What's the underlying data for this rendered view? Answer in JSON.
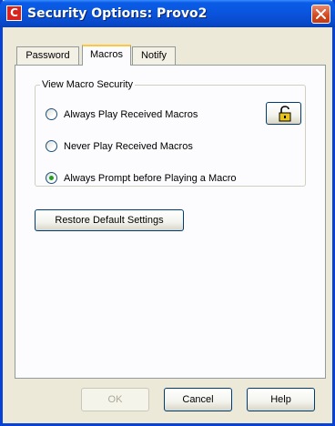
{
  "window": {
    "title": "Security Options:  Provo2",
    "app_icon_letter": "C"
  },
  "tabs": [
    {
      "label": "Password",
      "active": false
    },
    {
      "label": "Macros",
      "active": true
    },
    {
      "label": "Notify",
      "active": false
    }
  ],
  "macro_security": {
    "group_label": "View Macro Security",
    "options": [
      {
        "label": "Always Play Received Macros",
        "selected": false
      },
      {
        "label": "Never Play Received Macros",
        "selected": false
      },
      {
        "label": "Always Prompt before Playing a Macro",
        "selected": true
      }
    ],
    "lock_icon": "unlocked-padlock-icon"
  },
  "restore_button_label": "Restore Default Settings",
  "footer": {
    "ok_label": "OK",
    "cancel_label": "Cancel",
    "help_label": "Help"
  },
  "colors": {
    "titlebar": "#0a54dd",
    "close_button": "#d2491f",
    "dialog_background": "#ece9d8",
    "tab_highlight": "#ffc83c",
    "radio_selected": "#21a121",
    "padlock": "#e6c21a"
  }
}
